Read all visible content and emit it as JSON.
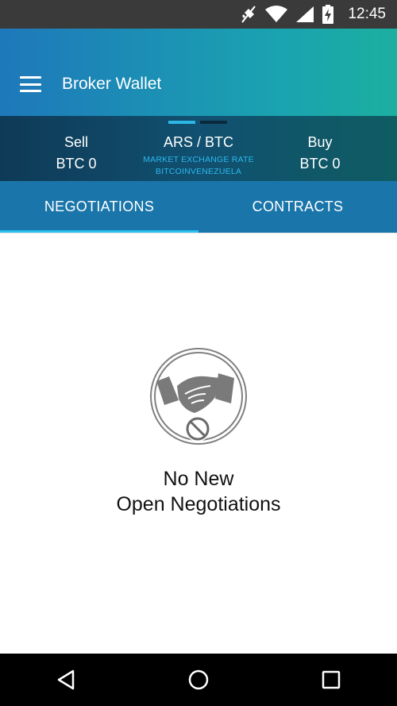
{
  "status_bar": {
    "time": "12:45",
    "icons": [
      "no-vibration-icon",
      "wifi-icon",
      "cell-signal-icon",
      "battery-charging-icon"
    ]
  },
  "app_bar": {
    "title": "Broker Wallet",
    "menu_icon": "hamburger-menu-icon"
  },
  "rate_bar": {
    "pager": {
      "pages": 2,
      "active": 0,
      "active_color": "#2bb6e6"
    },
    "sell": {
      "label": "Sell",
      "value": "BTC 0"
    },
    "pair": {
      "label": "ARS / BTC",
      "sub1": "MARKET EXCHANGE RATE",
      "sub2": "BITCOINVENEZUELA"
    },
    "buy": {
      "label": "Buy",
      "value": "BTC 0"
    }
  },
  "tabs": [
    {
      "label": "NEGOTIATIONS",
      "active": true
    },
    {
      "label": "CONTRACTS",
      "active": false
    }
  ],
  "empty_state": {
    "icon": "handshake-blocked-icon",
    "line1": "No New",
    "line2": "Open Negotiations"
  },
  "nav_bar": {
    "buttons": [
      "back-icon",
      "home-icon",
      "recents-icon"
    ]
  },
  "colors": {
    "accent": "#2bb6e6",
    "tab_bg": "#1a76aa",
    "header_gradient_start": "#1e78ba",
    "header_gradient_end": "#1cafa0"
  }
}
